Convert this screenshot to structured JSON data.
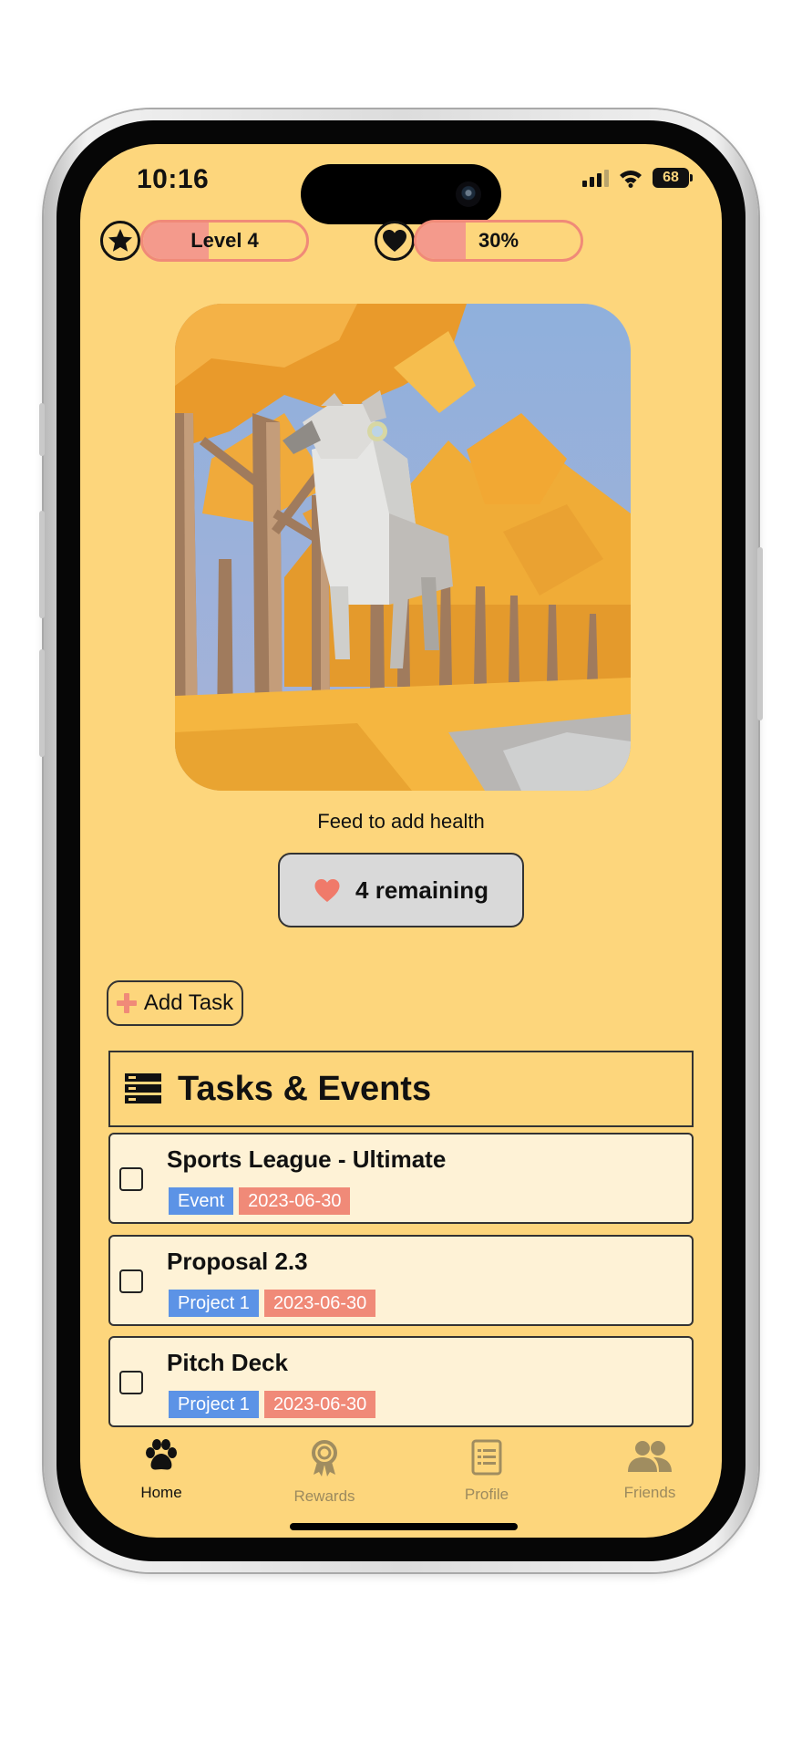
{
  "status_bar": {
    "time": "10:16",
    "battery": "68"
  },
  "stats": {
    "level": {
      "label": "Level 4",
      "progress": 0.4
    },
    "health": {
      "label": "30%",
      "progress": 0.3
    }
  },
  "pet": {
    "scene": "low-poly-deer-autumn-forest"
  },
  "feed": {
    "caption": "Feed to add health",
    "button_label": "4 remaining"
  },
  "add_task": {
    "label": "Add Task"
  },
  "tasks": {
    "title": "Tasks & Events",
    "items": [
      {
        "title": "Sports League - Ultimate",
        "type": "Event",
        "date": "2023-06-30",
        "checked": false
      },
      {
        "title": "Proposal 2.3",
        "type": "Project 1",
        "date": "2023-06-30",
        "checked": false
      },
      {
        "title": "Pitch Deck",
        "type": "Project 1",
        "date": "2023-06-30",
        "checked": false
      }
    ]
  },
  "tab_bar": {
    "items": [
      {
        "label": "Home",
        "icon": "paw-icon",
        "active": true
      },
      {
        "label": "Rewards",
        "icon": "award-icon",
        "active": false
      },
      {
        "label": "Profile",
        "icon": "list-icon",
        "active": false
      },
      {
        "label": "Friends",
        "icon": "people-icon",
        "active": false
      }
    ]
  },
  "colors": {
    "background": "#fdd67c",
    "accent": "#f08a78",
    "tag_type": "#5c93e6",
    "tag_date": "#f08a78",
    "card": "#fef2d6"
  }
}
